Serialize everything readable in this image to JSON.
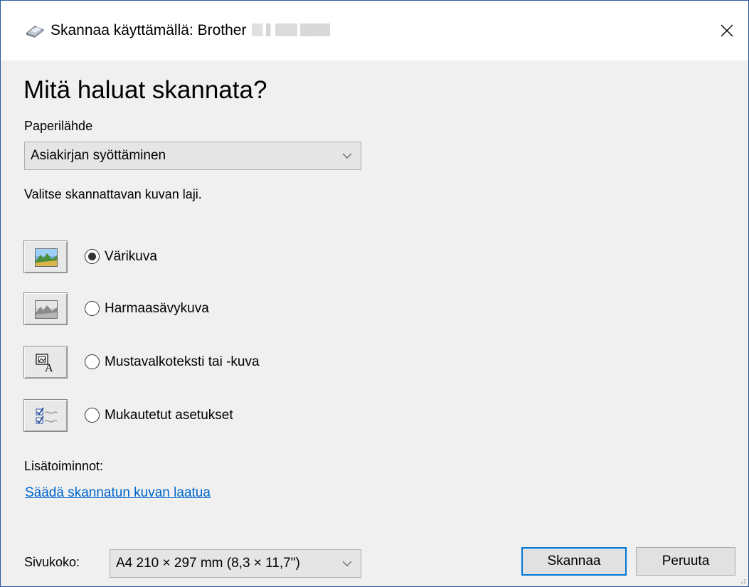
{
  "window": {
    "title": "Skannaa käyttämällä: Brother",
    "title_model_redacted": true,
    "close_icon": "close-icon",
    "app_icon": "scanner-icon"
  },
  "main": {
    "heading": "Mitä haluat skannata?",
    "paper_source": {
      "label": "Paperilähde",
      "value": "Asiakirjan syöttäminen"
    },
    "picture_type_prompt": "Valitse skannattavan kuvan laji.",
    "picture_types": [
      {
        "label": "Värikuva",
        "selected": true,
        "icon": "color-picture-icon"
      },
      {
        "label": "Harmaasävykuva",
        "selected": false,
        "icon": "grayscale-picture-icon"
      },
      {
        "label": "Mustavalkoteksti tai -kuva",
        "selected": false,
        "icon": "black-white-text-icon"
      },
      {
        "label": "Mukautetut asetukset",
        "selected": false,
        "icon": "custom-settings-icon"
      }
    ],
    "extra_options_label": "Lisätoiminnot:",
    "adjust_quality_link": "Säädä skannatun kuvan laatua"
  },
  "footer": {
    "page_size_label": "Sivukoko:",
    "page_size_value": "A4 210 × 297 mm (8,3 × 11,7\")",
    "scan_button": "Skannaa",
    "cancel_button": "Peruuta"
  },
  "colors": {
    "link": "#0066cc",
    "default_button_border": "#0078d7",
    "window_border": "#2b579a"
  }
}
